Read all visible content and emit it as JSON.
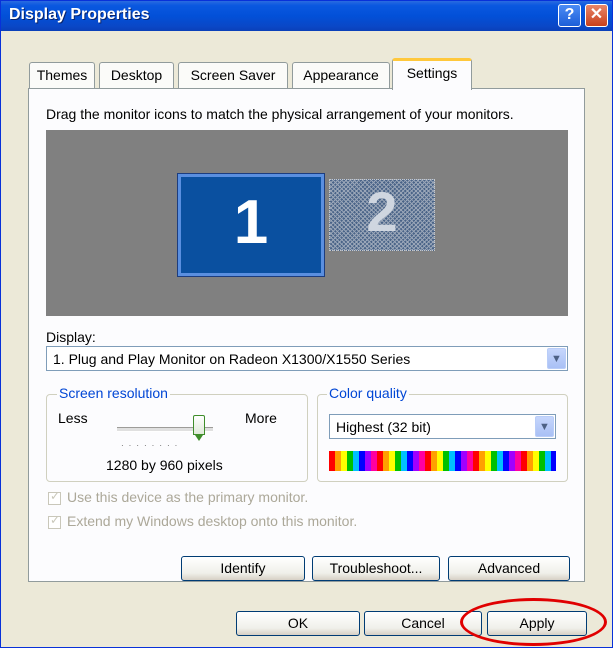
{
  "window": {
    "title": "Display Properties",
    "help_glyph": "?",
    "close_glyph": "✕"
  },
  "tabs": [
    {
      "label": "Themes"
    },
    {
      "label": "Desktop"
    },
    {
      "label": "Screen Saver"
    },
    {
      "label": "Appearance"
    },
    {
      "label": "Settings",
      "active": true
    }
  ],
  "settings": {
    "instruction": "Drag the monitor icons to match the physical arrangement of your monitors.",
    "monitors": [
      {
        "label": "1",
        "selected": true
      },
      {
        "label": "2",
        "selected": false
      }
    ],
    "display_label": "Display:",
    "display_value": "1. Plug and Play Monitor on Radeon X1300/X1550 Series",
    "resolution": {
      "group_title": "Screen resolution",
      "less": "Less",
      "more": "More",
      "value_text": "1280 by 960 pixels",
      "slider_level": 1.0
    },
    "color_quality": {
      "group_title": "Color quality",
      "value": "Highest (32 bit)"
    },
    "checkboxes": [
      {
        "label": "Use this device as the primary monitor.",
        "checked": true,
        "enabled": false
      },
      {
        "label": "Extend my Windows desktop onto this monitor.",
        "checked": true,
        "enabled": false
      }
    ],
    "buttons": {
      "identify": "Identify",
      "troubleshoot": "Troubleshoot...",
      "advanced": "Advanced"
    }
  },
  "footer": {
    "ok": "OK",
    "cancel": "Cancel",
    "apply": "Apply"
  },
  "colors": {
    "title_bar": "#0a58e0",
    "highlight_circle": "#e00000",
    "tab_active_accent": "#ffc83c"
  }
}
